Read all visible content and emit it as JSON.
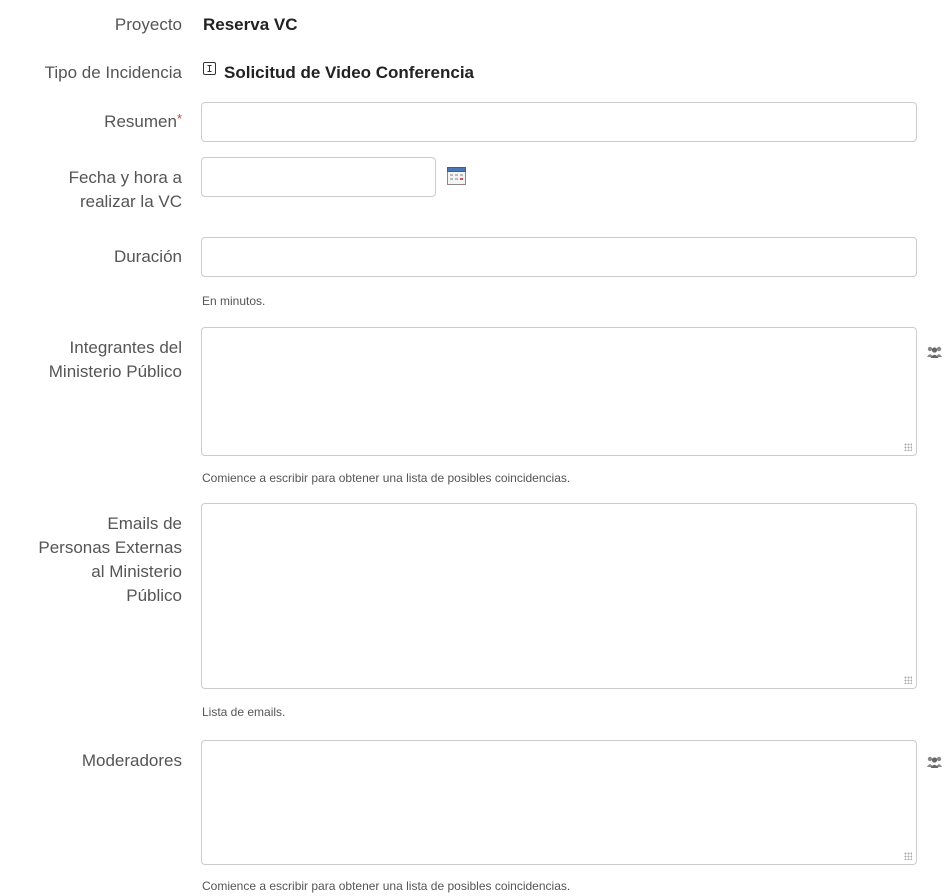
{
  "project": {
    "label": "Proyecto",
    "value": "Reserva VC"
  },
  "issue_type": {
    "label": "Tipo de Incidencia",
    "value": "Solicitud de Video Conferencia",
    "icon": "issue-type-icon"
  },
  "summary": {
    "label": "Resumen",
    "required_mark": "*",
    "value": ""
  },
  "datetime": {
    "label_line1": "Fecha y hora a",
    "label_line2": "realizar la VC",
    "value": "",
    "icon": "calendar-icon"
  },
  "duration": {
    "label": "Duración",
    "value": "",
    "help": "En minutos."
  },
  "members": {
    "label_line1": "Integrantes del",
    "label_line2": "Ministerio Público",
    "value": "",
    "help": "Comience a escribir para obtener una lista de posibles coincidencias.",
    "icon": "people-picker-icon"
  },
  "external_emails": {
    "label_line1": "Emails de",
    "label_line2": "Personas Externas",
    "label_line3": "al Ministerio",
    "label_line4": "Público",
    "value": "",
    "help": "Lista de emails."
  },
  "moderators": {
    "label": "Moderadores",
    "value": "",
    "help": "Comience a escribir para obtener una lista de posibles coincidencias.",
    "icon": "people-picker-icon"
  },
  "colors": {
    "required": "#d04437",
    "border": "#cccccc",
    "label": "#555555"
  }
}
